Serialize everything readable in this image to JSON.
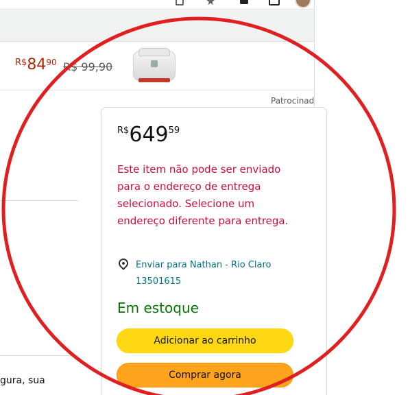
{
  "sponsored_product": {
    "price_currency": "R$",
    "price_whole": "84",
    "price_fraction": "90",
    "old_price": "R$ 99,90"
  },
  "sponsored_label": "Patrocinado",
  "left_snippet": "gura, sua",
  "buybox": {
    "price_currency": "R$",
    "price_whole": "649",
    "price_fraction": "59",
    "warning": "Este item não pode ser enviado para o endereço de entrega selecionado. Selecione um endereço diferente para entrega.",
    "ship_to_line1": "Enviar para Nathan - Rio Claro",
    "ship_to_line2": "13501615",
    "stock_status": "Em estoque",
    "add_to_cart_label": "Adicionar ao carrinho",
    "buy_now_label": "Comprar agora"
  },
  "colors": {
    "price_red": "#b12704",
    "warning_red": "#cc0c39",
    "link_teal": "#007185",
    "stock_green": "#007600",
    "cart_yellow": "#ffd814",
    "buy_orange": "#ffa41c",
    "annotation_red": "#e02020"
  },
  "icons": [
    "bookmark-icon",
    "star-icon",
    "extensions-icon",
    "window-icon",
    "location-pin-icon"
  ]
}
